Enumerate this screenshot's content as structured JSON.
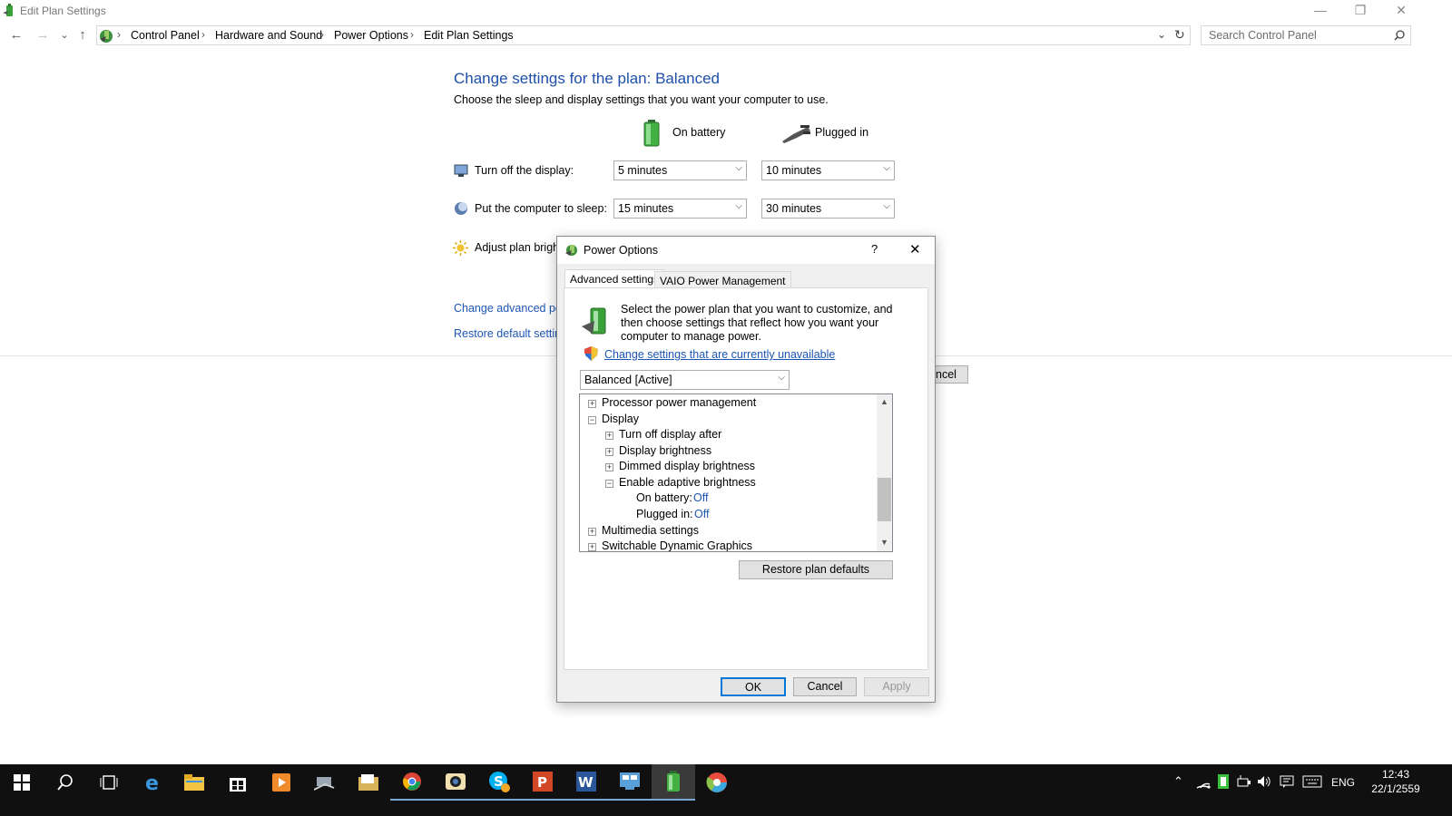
{
  "window": {
    "title": "Edit Plan Settings",
    "minimize": "—",
    "restore": "❐",
    "close": "✕"
  },
  "nav": {
    "back": "←",
    "forward": "→",
    "recent": "⌄",
    "up": "↑",
    "dropdown": "⌄",
    "refresh": "↻"
  },
  "breadcrumb": {
    "items": [
      "Control Panel",
      "Hardware and Sound",
      "Power Options",
      "Edit Plan Settings"
    ],
    "sep": "›"
  },
  "search": {
    "placeholder": "Search Control Panel"
  },
  "plan": {
    "title": "Change settings for the plan: Balanced",
    "subtitle": "Choose the sleep and display settings that you want your computer to use.",
    "col_battery": "On battery",
    "col_plugged": "Plugged in",
    "rows": {
      "display": {
        "label": "Turn off the display:",
        "battery": "5 minutes",
        "plugged": "10 minutes"
      },
      "sleep": {
        "label": "Put the computer to sleep:",
        "battery": "15 minutes",
        "plugged": "30 minutes"
      },
      "brightness": {
        "label": "Adjust plan brightness"
      }
    },
    "links": {
      "advanced": "Change advanced power settings",
      "restore": "Restore default settings for this plan"
    },
    "cancel_partial": "ncel"
  },
  "dialog": {
    "title": "Power Options",
    "help": "?",
    "close": "✕",
    "tabs": [
      "Advanced settings",
      "VAIO Power Management"
    ],
    "intro_lines": [
      "Select the power plan that you want to customize, and",
      "then choose settings that reflect how you want your",
      "computer to manage power."
    ],
    "admin_link": "Change settings that are currently unavailable",
    "plan_select": "Balanced [Active]",
    "tree": [
      {
        "label": "Processor power management",
        "box": "+"
      },
      {
        "label": "Display",
        "box": "−"
      },
      {
        "label": "Turn off display after",
        "box": "+"
      },
      {
        "label": "Display brightness",
        "box": "+"
      },
      {
        "label": "Dimmed display brightness",
        "box": "+"
      },
      {
        "label": "Enable adaptive brightness",
        "box": "−"
      },
      {
        "label": "On battery:",
        "value": "Off"
      },
      {
        "label": "Plugged in:",
        "value": "Off"
      },
      {
        "label": "Multimedia settings",
        "box": "+"
      },
      {
        "label": "Switchable Dynamic Graphics",
        "box": "+"
      }
    ],
    "restore_defaults": "Restore plan defaults",
    "ok": "OK",
    "cancel": "Cancel",
    "apply": "Apply"
  },
  "taskbar": {
    "tray": {
      "language": "ENG",
      "time": "12:43",
      "date": "22/1/2559"
    }
  },
  "colors": {
    "link": "#1c55b5",
    "heading": "#1e4fa8",
    "taskbar": "#101010"
  }
}
